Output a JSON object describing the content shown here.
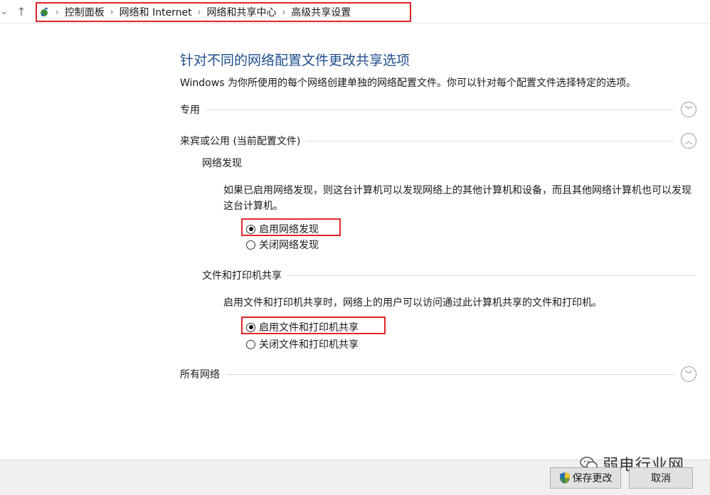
{
  "breadcrumb": {
    "items": [
      "控制面板",
      "网络和 Internet",
      "网络和共享中心",
      "高级共享设置"
    ]
  },
  "page": {
    "title": "针对不同的网络配置文件更改共享选项",
    "description": "Windows 为你所使用的每个网络创建单独的网络配置文件。你可以针对每个配置文件选择特定的选项。"
  },
  "sections": {
    "private": {
      "label": "专用"
    },
    "guest_public": {
      "label": "来宾或公用 (当前配置文件)"
    },
    "all_networks": {
      "label": "所有网络"
    }
  },
  "network_discovery": {
    "heading": "网络发现",
    "description": "如果已启用网络发现，则这台计算机可以发现网络上的其他计算机和设备，而且其他网络计算机也可以发现这台计算机。",
    "option_on": "启用网络发现",
    "option_off": "关闭网络发现",
    "selected": "on"
  },
  "file_sharing": {
    "heading": "文件和打印机共享",
    "description": "启用文件和打印机共享时，网络上的用户可以访问通过此计算机共享的文件和打印机。",
    "option_on": "启用文件和打印机共享",
    "option_off": "关闭文件和打印机共享",
    "selected": "on"
  },
  "buttons": {
    "save": "保存更改",
    "cancel": "取消"
  },
  "watermark": {
    "text": "弱电行业网"
  },
  "colors": {
    "highlight_border": "#e0262b",
    "title_blue": "#1e4e8c"
  }
}
